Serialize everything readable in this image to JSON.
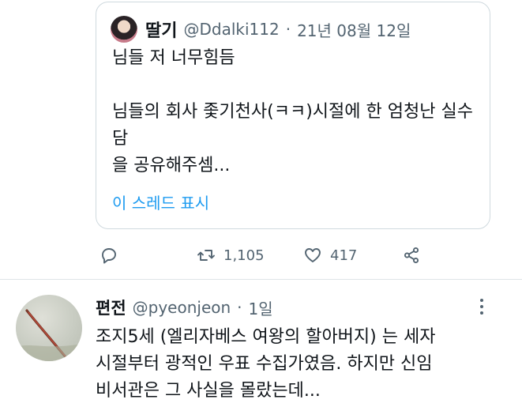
{
  "quoted_tweet": {
    "name": "딸기",
    "handle": "@Ddalki112",
    "separator": "·",
    "date": "21년 08월 12일",
    "body": "님들 저 너무힘듬\n\n님들의 회사 좇기천사(ㅋㅋ)시절에 한 엄청난 실수담\n을 공유해주셈...",
    "show_thread": "이 스레드 표시"
  },
  "actions": {
    "reply_icon": "reply-icon",
    "retweet_icon": "retweet-icon",
    "retweet_count": "1,105",
    "like_icon": "heart-icon",
    "like_count": "417",
    "share_icon": "share-icon"
  },
  "reply_tweet": {
    "name": "편전",
    "handle": "@pyeonjeon",
    "separator": "·",
    "time": "1일",
    "body": "조지5세 (엘리자베스 여왕의 할아버지) 는 세자\n시절부터 광적인 우표 수집가였음. 하지만 신임\n비서관은 그 사실을 몰랐는데..."
  },
  "colors": {
    "link": "#1d9bf0",
    "secondary_text": "#536471",
    "border": "#cfd9de"
  }
}
